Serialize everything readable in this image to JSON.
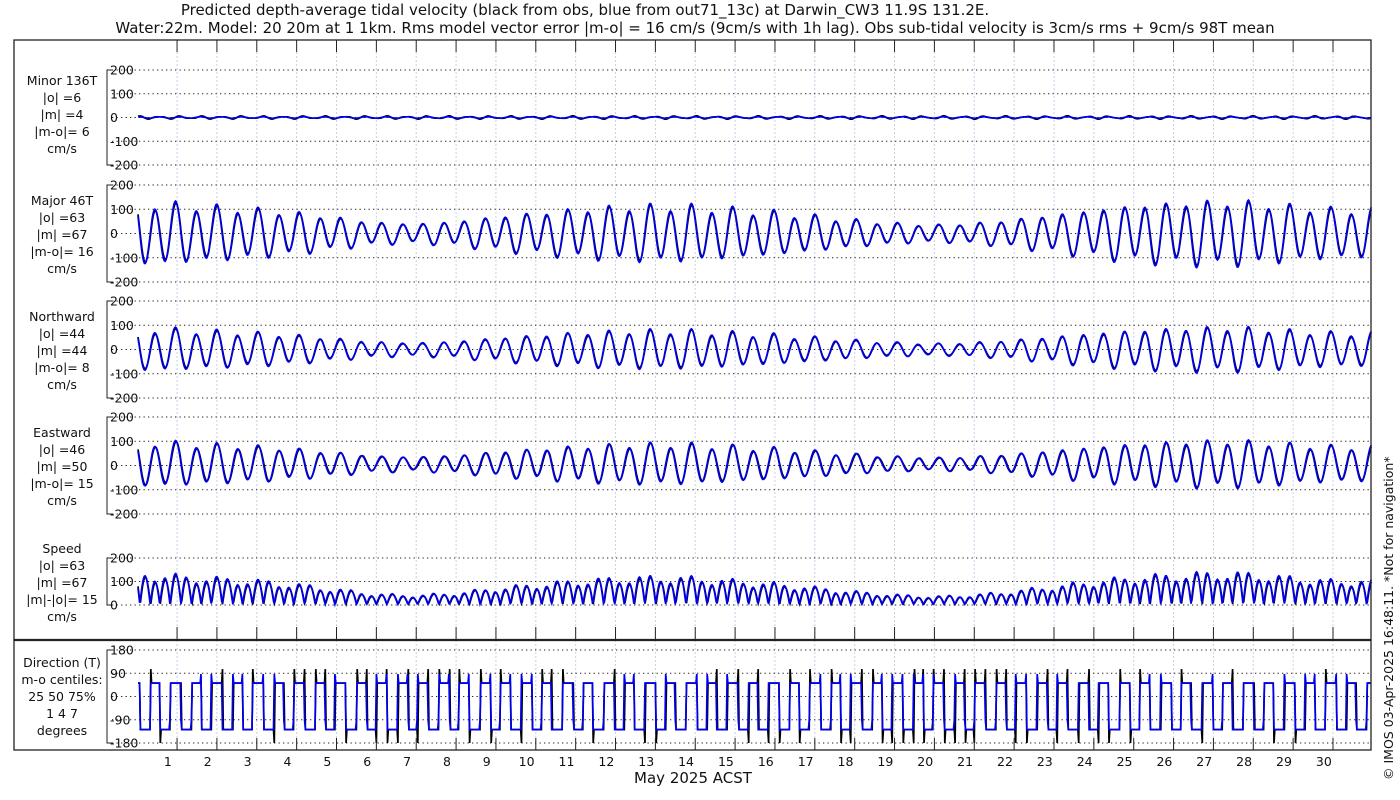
{
  "header": {
    "title_line1": "Predicted depth-average tidal velocity (black from obs, blue from out71_13c) at Darwin_CW3 11.9S 131.2E.",
    "title_line2": "Water:22m. Model: 20 20m at 1 1km. Rms model vector error |m-o| = 16 cm/s (9cm/s with 1h lag). Obs sub-tidal velocity is 3cm/s rms + 9cm/s 98T mean"
  },
  "copyright": "© IMOS 03-Apr-2025 16:48:11. *Not for navigation*",
  "colors": {
    "obs": "#000000",
    "model": "#0000ee",
    "grid": "#c8d0e8"
  },
  "chart_data": {
    "type": "line",
    "xlabel": "May 2025 ACST",
    "xticks": [
      "1",
      "2",
      "3",
      "4",
      "5",
      "6",
      "7",
      "8",
      "9",
      "10",
      "11",
      "12",
      "13",
      "14",
      "15",
      "16",
      "17",
      "18",
      "19",
      "20",
      "21",
      "22",
      "23",
      "24",
      "25",
      "26",
      "27",
      "28",
      "29",
      "30"
    ],
    "series_legend": [
      "black from obs",
      "blue from out71_13c"
    ],
    "daily_major_amplitude_obs_cm_s": [
      130,
      120,
      110,
      100,
      85,
      65,
      45,
      40,
      50,
      70,
      85,
      100,
      110,
      115,
      112,
      100,
      88,
      72,
      55,
      42,
      35,
      42,
      58,
      78,
      98,
      115,
      125,
      132,
      128,
      112,
      100
    ],
    "model_scale": 1.06,
    "panels": [
      {
        "key": "minor",
        "labels": [
          "Minor 136T",
          "|o| =6",
          "|m| =4",
          "|m-o|= 6",
          "cm/s"
        ],
        "yticks": [
          "200",
          "100",
          "0",
          "-100",
          "-200"
        ],
        "ylim": [
          -200,
          200
        ]
      },
      {
        "key": "major",
        "labels": [
          "Major 46T",
          "|o| =63",
          "|m| =67",
          "|m-o|= 16",
          "cm/s"
        ],
        "yticks": [
          "200",
          "100",
          "0",
          "-100",
          "-200"
        ],
        "ylim": [
          -200,
          200
        ]
      },
      {
        "key": "north",
        "labels": [
          "Northward",
          "|o| =44",
          "|m| =44",
          "|m-o|= 8",
          "cm/s"
        ],
        "yticks": [
          "200",
          "100",
          "0",
          "-100",
          "-200"
        ],
        "ylim": [
          -200,
          200
        ]
      },
      {
        "key": "east",
        "labels": [
          "Eastward",
          "|o| =46",
          "|m| =50",
          "|m-o|= 15",
          "cm/s"
        ],
        "yticks": [
          "200",
          "100",
          "0",
          "-100",
          "-200"
        ],
        "ylim": [
          -200,
          200
        ]
      },
      {
        "key": "speed",
        "labels": [
          "Speed",
          "|o| =63",
          "|m| =67",
          "|m|-|o|= 15",
          "cm/s"
        ],
        "yticks": [
          "200",
          "100",
          "0"
        ],
        "ylim": [
          0,
          200
        ]
      },
      {
        "key": "dir",
        "labels": [
          "Direction (T)",
          "m-o centiles:",
          "25  50  75%",
          "1  4  7",
          "degrees"
        ],
        "yticks": [
          "180",
          "90",
          "0",
          "-90",
          "-180"
        ],
        "ylim": [
          -180,
          180
        ]
      }
    ]
  }
}
